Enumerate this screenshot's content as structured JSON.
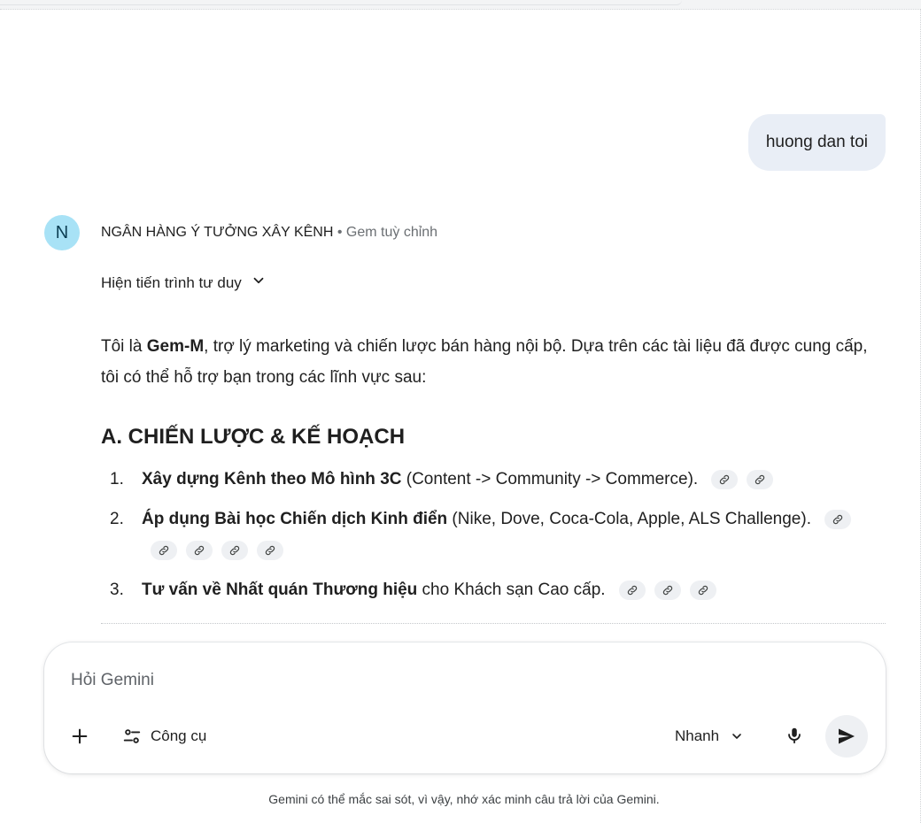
{
  "user_message": "huong dan toi",
  "gem": {
    "avatar_letter": "N",
    "name": "NGÂN HÀNG Ý TƯỞNG XÂY KÊNH",
    "separator": "•",
    "type": "Gem tuỳ chỉnh",
    "thinking_toggle": "Hiện tiến trình tư duy"
  },
  "answer": {
    "intro_before": "Tôi là ",
    "intro_bold": "Gem-M",
    "intro_after": ", trợ lý marketing và chiến lược bán hàng nội bộ. Dựa trên các tài liệu đã được cung cấp, tôi có thể hỗ trợ bạn trong các lĩnh vực sau:",
    "heading": "A. CHIẾN LƯỢC & KẾ HOẠCH",
    "items": [
      {
        "num": "1.",
        "bold": "Xây dựng Kênh theo Mô hình 3C",
        "rest": " (Content -> Community -> Commerce)."
      },
      {
        "num": "2.",
        "bold": "Áp dụng Bài học Chiến dịch Kinh điển",
        "rest": " (Nike, Dove, Coca-Cola, Apple, ALS Challenge)."
      },
      {
        "num": "3.",
        "bold": "Tư vấn về Nhất quán Thương hiệu",
        "rest": " cho Khách sạn Cao cấp."
      }
    ]
  },
  "composer": {
    "placeholder": "Hỏi Gemini",
    "tools_label": "Công cụ",
    "mode_label": "Nhanh"
  },
  "icons": {
    "add": "plus-icon",
    "tools": "tune-icon",
    "mode": "chevron-down-icon",
    "mic": "mic-icon",
    "send": "send-icon",
    "citation": "link-icon"
  },
  "colors": {
    "user_bubble": "#e9eef6",
    "avatar_bg": "#a8e2f6",
    "citation_bg": "#eef0f3",
    "muted_text": "#6b6f73"
  },
  "disclaimer": "Gemini có thể mắc sai sót, vì vậy, nhớ xác minh câu trả lời của Gemini."
}
